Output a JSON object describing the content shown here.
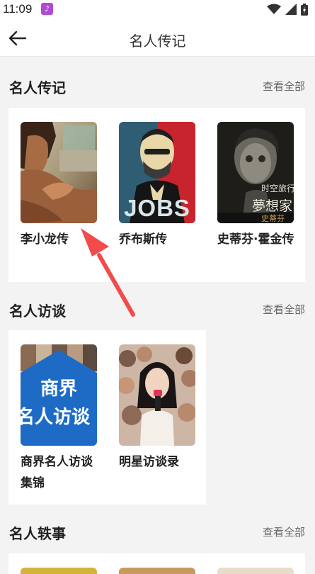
{
  "status_bar": {
    "time": "11:09",
    "app_icon": "notification-app-icon"
  },
  "app_bar": {
    "title": "名人传记",
    "back_icon": "back-arrow-icon"
  },
  "sections": [
    {
      "title": "名人传记",
      "more": "查看全部",
      "books": [
        {
          "title": "李小龙传"
        },
        {
          "title": "乔布斯传",
          "cover_text": "JOBS"
        },
        {
          "title": "史蒂芬·霍金传",
          "cover_text": "夢想家"
        }
      ]
    },
    {
      "title": "名人访谈",
      "more": "查看全部",
      "books": [
        {
          "title": "商界名人访谈集锦",
          "cover_text_1": "商界",
          "cover_text_2": "名人访谈"
        },
        {
          "title": "明星访谈录"
        }
      ]
    },
    {
      "title": "名人轶事",
      "more": "查看全部"
    }
  ],
  "colors": {
    "accent_arrow": "#f24b4b",
    "background": "#f3f3f3"
  }
}
